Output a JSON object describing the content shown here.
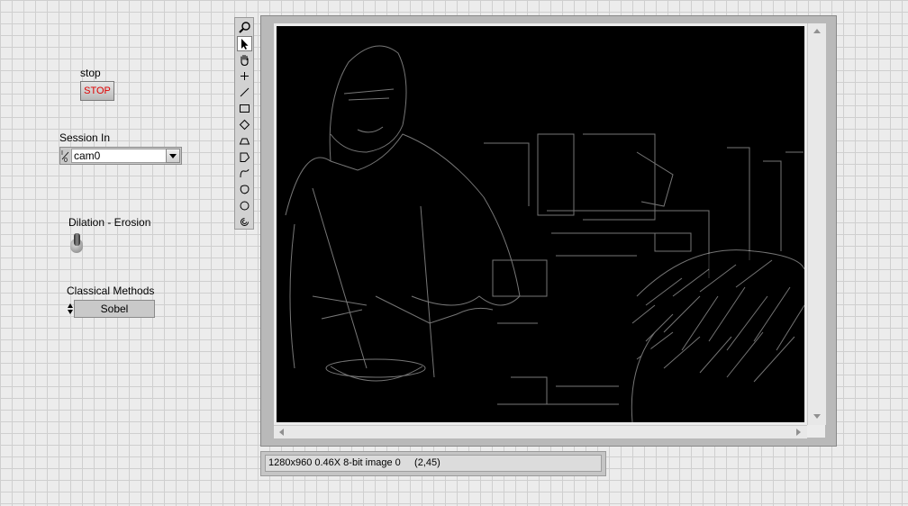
{
  "controls": {
    "stop": {
      "label": "stop",
      "button_text": "STOP",
      "text_color": "#e00000"
    },
    "session_in": {
      "label": "Session In",
      "io_glyph": "I/O",
      "value": "cam0"
    },
    "dilation_erosion": {
      "label": "Dilation - Erosion"
    },
    "classical_methods": {
      "label": "Classical Methods",
      "value": "Sobel"
    }
  },
  "palette": {
    "tools": [
      {
        "name": "zoom-icon"
      },
      {
        "name": "pointer-icon"
      },
      {
        "name": "pan-hand-icon"
      },
      {
        "name": "point-crosshair-icon"
      },
      {
        "name": "line-icon"
      },
      {
        "name": "rectangle-icon"
      },
      {
        "name": "rotated-rectangle-icon"
      },
      {
        "name": "annulus-segment-icon"
      },
      {
        "name": "polygon-icon"
      },
      {
        "name": "freehand-line-icon"
      },
      {
        "name": "freehand-region-icon"
      },
      {
        "name": "oval-icon"
      },
      {
        "name": "annulus-icon"
      }
    ],
    "selected_tool": "pointer-icon"
  },
  "image_display": {
    "content": "dark Sobel edge-detected camera frame",
    "background": "#000000"
  },
  "status_bar": {
    "text": "1280x960 0.46X 8-bit image 0     (2,45)"
  },
  "colors": {
    "panel_bg": "#ececec",
    "grid": "#cfcfcf",
    "stop_text": "#e00000"
  }
}
